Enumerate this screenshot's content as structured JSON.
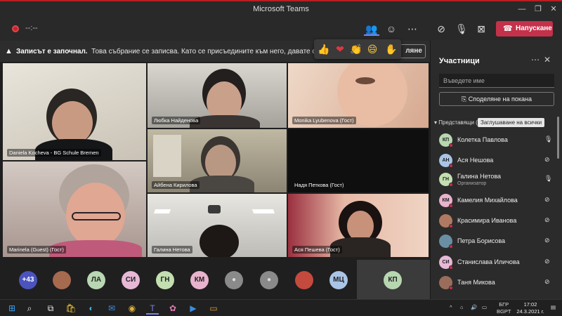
{
  "window": {
    "title": "Microsoft Teams"
  },
  "toolbar": {
    "timer": "--:--",
    "leave_label": "Напускане"
  },
  "banner": {
    "bold": "Записът е започнал.",
    "text": "Това събрание се записва. Като се присъедините към него, давате съгласието си за този з",
    "button_tail": "ляне"
  },
  "reactions": [
    "thumbs-up",
    "heart",
    "clap",
    "laugh",
    "raise-hand"
  ],
  "tiles": [
    {
      "name": "Daniela Kocheva - BG Schule Bremen"
    },
    {
      "name": "Любка Найденова"
    },
    {
      "name": "Monika Lyubenova (Гост)"
    },
    {
      "name": "Айбена Кирилова"
    },
    {
      "name": "Надя Петкова (Гост)"
    },
    {
      "name": "Marinela (Guest) (Гост)"
    },
    {
      "name": "Галина Нетова"
    },
    {
      "name": "Ася Пешева (Гост)"
    }
  ],
  "bottom_bar": {
    "overflow": "+43",
    "avatars": [
      "",
      "ЛА",
      "СИ",
      "ГН",
      "КМ",
      "",
      "",
      "",
      "МЦ"
    ],
    "current": "КП"
  },
  "panel": {
    "title": "Участници",
    "search_placeholder": "Въведете име",
    "share_label": "Споделяне на покана",
    "section_label": "Представящи (8)",
    "mute_all_label": "Заглушаване на всички",
    "people": [
      {
        "initials": "КП",
        "name": "Колетка Павлова",
        "role": "",
        "color": "#b7d7b1"
      },
      {
        "initials": "АН",
        "name": "Ася Нешова",
        "role": "",
        "color": "#a9c4e6"
      },
      {
        "initials": "ГН",
        "name": "Галина Нетова",
        "role": "Организатор",
        "color": "#c3dfb1"
      },
      {
        "initials": "КМ",
        "name": "Камелия Михайлова",
        "role": "",
        "color": "#e9b3cd"
      },
      {
        "initials": "",
        "name": "Красимира Иванова",
        "role": "",
        "color": "#b07a62"
      },
      {
        "initials": "",
        "name": "Петра Борисова",
        "role": "",
        "color": "#6a8fa3"
      },
      {
        "initials": "СИ",
        "name": "Станислава Иличова",
        "role": "",
        "color": "#e7b8d6"
      },
      {
        "initials": "",
        "name": "Таня Микова",
        "role": "",
        "color": "#9a6d5b"
      }
    ]
  },
  "taskbar": {
    "lang": "БГР",
    "lang2": "BGPT",
    "time": "17:02",
    "date": "24.3.2021 г."
  }
}
